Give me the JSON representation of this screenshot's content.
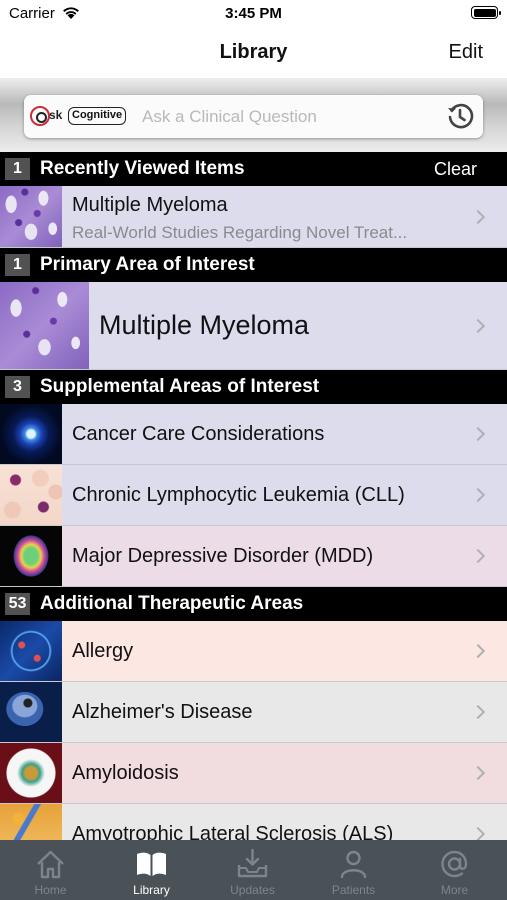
{
  "status": {
    "carrier": "Carrier",
    "time": "3:45 PM"
  },
  "nav": {
    "title": "Library",
    "edit_label": "Edit"
  },
  "search": {
    "logo_prefix": "sk",
    "logo_badge": "Cognitive",
    "placeholder": "Ask a Clinical Question"
  },
  "recent": {
    "count": "1",
    "title": "Recently Viewed Items",
    "clear_label": "Clear",
    "items": [
      {
        "title": "Multiple Myeloma",
        "subtitle": "Real-World Studies Regarding Novel Treat..."
      }
    ]
  },
  "primary": {
    "count": "1",
    "title": "Primary Area of Interest",
    "items": [
      {
        "title": "Multiple Myeloma"
      }
    ]
  },
  "supplemental": {
    "count": "3",
    "title": "Supplemental Areas of Interest",
    "items": [
      {
        "title": "Cancer Care Considerations",
        "bg": "#dcdcec"
      },
      {
        "title": "Chronic Lymphocytic Leukemia (CLL)",
        "bg": "#dcdcec"
      },
      {
        "title": "Major Depressive Disorder (MDD)",
        "bg": "#ecdce8"
      }
    ]
  },
  "additional": {
    "count": "53",
    "title": "Additional Therapeutic Areas",
    "items": [
      {
        "title": "Allergy",
        "bg": "#fde7e2"
      },
      {
        "title": "Alzheimer's Disease",
        "bg": "#e8e8e8"
      },
      {
        "title": "Amyloidosis",
        "bg": "#f1dcdf"
      },
      {
        "title": "Amyotrophic Lateral Sclerosis (ALS)",
        "bg": "#e8e8e8"
      }
    ]
  },
  "tabs": [
    {
      "label": "Home",
      "icon": "home-icon",
      "active": false
    },
    {
      "label": "Library",
      "icon": "book-icon",
      "active": true
    },
    {
      "label": "Updates",
      "icon": "inbox-download-icon",
      "active": false
    },
    {
      "label": "Patients",
      "icon": "person-icon",
      "active": false
    },
    {
      "label": "More",
      "icon": "at-sign-icon",
      "active": false
    }
  ],
  "colors": {
    "header_bg": "#000000",
    "count_badge": "#525252",
    "tab_bar": "#4a5257",
    "tab_active": "#ffffff",
    "tab_inactive": "#7c858c",
    "primary_row_bg": "#dcdcec",
    "recent_row_bg": "#dcdcec"
  }
}
